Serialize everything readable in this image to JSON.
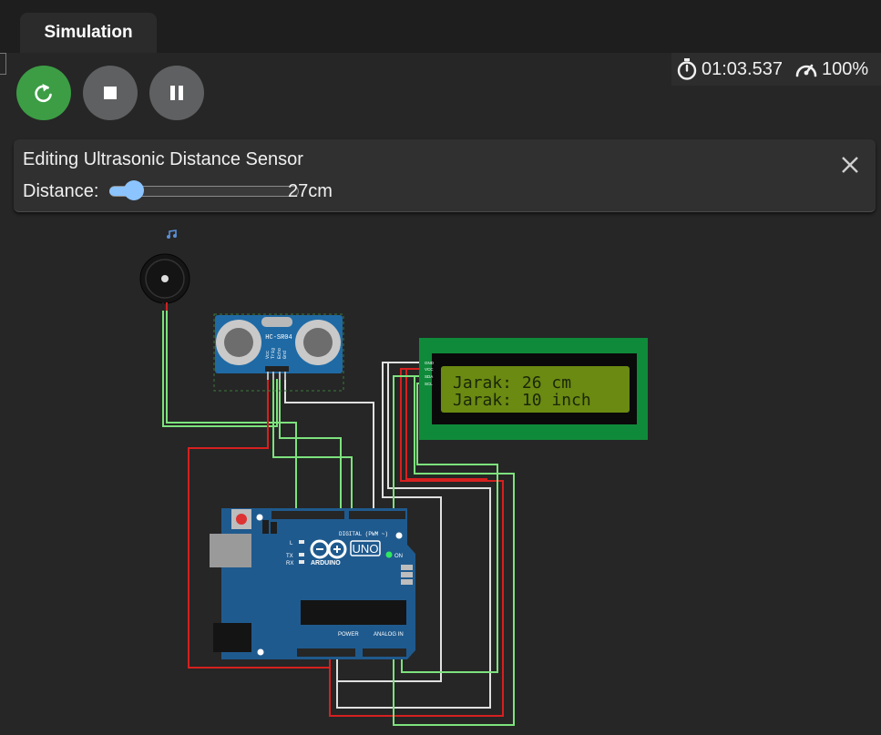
{
  "tabs": [
    {
      "label": "Simulation"
    }
  ],
  "toolbar": {
    "restart_icon": "restart-icon",
    "stop_icon": "stop-icon",
    "pause_icon": "pause-icon"
  },
  "status": {
    "timer_icon": "stopwatch-icon",
    "elapsed": "01:03.537",
    "speed_icon": "speedometer-icon",
    "speed": "100%"
  },
  "editor": {
    "title": "Editing Ultrasonic Distance Sensor",
    "label": "Distance:",
    "value": "27cm",
    "slider_fraction": 0.07
  },
  "circuit": {
    "sensor_label": "HC-SR04",
    "sensor_pins": [
      "Vcc",
      "Trig",
      "Echo",
      "Gnd"
    ],
    "lcd_lines": [
      "Jarak: 26 cm",
      "Jarak: 10 inch"
    ],
    "lcd_pins": [
      "GND",
      "VCC",
      "SDA",
      "SCL"
    ],
    "arduino_logo": "UNO",
    "arduino_brand": "ARDUINO",
    "digital_label": "DIGITAL (PWM ~)",
    "power_label": "POWER",
    "analog_label": "ANALOG IN",
    "on_label": "ON",
    "tx_label": "TX",
    "rx_label": "RX",
    "l_label": "L"
  },
  "colors": {
    "accent_green": "#3c9d45",
    "slider_blue": "#8bc4ff",
    "board_blue": "#1f5a8e",
    "lcd_green": "#0f8a3a",
    "lcd_screen": "#6a8a12",
    "wire_green": "#7de27d",
    "wire_red": "#d62020",
    "wire_white": "#e0e0e0"
  }
}
